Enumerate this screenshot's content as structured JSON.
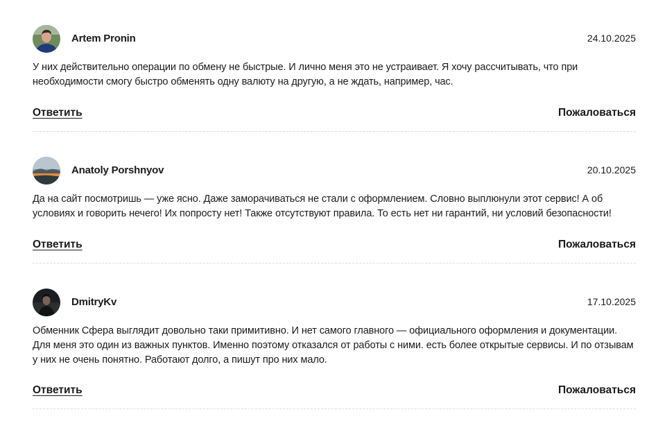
{
  "reviews": [
    {
      "author": "Artem Pronin",
      "date": "24.10.2025",
      "text": "У них действительно операции по обмену не быстрые. И лично меня это не устраивает. Я хочу рассчитывать, что при необходимости смогу быстро обменять одну валюту на другую, а не ждать, например, час.",
      "reply_label": "Ответить",
      "complain_label": "Пожаловаться",
      "avatar_icon": "user-photo"
    },
    {
      "author": "Anatoly Porshnyov",
      "date": "20.10.2025",
      "text": "Да на сайт посмотришь — уже ясно. Даже заморачиваться не стали с оформлением. Словно выплюнули этот сервис! А об условиях и говорить нечего! Их попросту нет! Также отсутствуют правила. То есть нет ни гарантий, ни условий безопасности!",
      "reply_label": "Ответить",
      "complain_label": "Пожаловаться",
      "avatar_icon": "landscape-photo"
    },
    {
      "author": "DmitryKv",
      "date": "17.10.2025",
      "text": "Обменник Сфера выглядит довольно таки примитивно. И нет самого главного — официального оформления и документации. Для меня это один из важных пунктов. Именно поэтому отказался от работы с ними. есть более открытые сервисы. И по отзывам у них не очень понятно. Работают долго, а пишут про них мало.",
      "reply_label": "Ответить",
      "complain_label": "Пожаловаться",
      "avatar_icon": "user-photo-dark"
    }
  ]
}
